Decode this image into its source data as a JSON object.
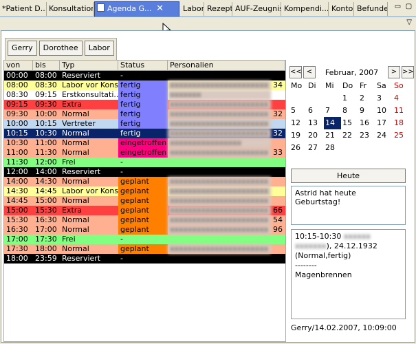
{
  "tabs": [
    {
      "label": "*Patient D..."
    },
    {
      "label": "Konsultation"
    },
    {
      "label": "Agenda G...",
      "active": true
    },
    {
      "label": "Labor"
    },
    {
      "label": "Rezept"
    },
    {
      "label": "AUF-Zeugnis"
    },
    {
      "label": "Kompendi..."
    },
    {
      "label": "Konto"
    },
    {
      "label": "Befunde"
    }
  ],
  "toolbar": {
    "buttons": [
      "Gerry",
      "Dorothee",
      "Labor"
    ]
  },
  "grid": {
    "headers": [
      "von",
      "bis",
      "Typ",
      "Status",
      "Personalien"
    ],
    "rows": [
      {
        "von": "00:00",
        "bis": "08:00",
        "typ": "Reserviert",
        "status": "-",
        "pers": "",
        "extra": "",
        "rowbg": "#000000",
        "fg": "#ffffff",
        "statusbg": "#000000"
      },
      {
        "von": "08:00",
        "bis": "08:30",
        "typ": "Labor vor Kons",
        "status": "fertig",
        "pers": "xxxxxxxxxxxxxxxxxxxxxx",
        "extra": "34",
        "rowbg": "#ffff99",
        "fg": "#000000",
        "statusbg": "#8080ff"
      },
      {
        "von": "08:30",
        "bis": "09:15",
        "typ": "Erstkonsultati...",
        "status": "fertig",
        "pers": "xxxxxxx",
        "extra": "",
        "rowbg": "#ffffff",
        "fg": "#000000",
        "statusbg": "#8080ff"
      },
      {
        "von": "09:15",
        "bis": "09:30",
        "typ": "Extra",
        "status": "fertig",
        "pers": "xxxxxxxxxxxxxxxxxxxxxx",
        "extra": "",
        "rowbg": "#ff4040",
        "fg": "#000000",
        "statusbg": "#8080ff"
      },
      {
        "von": "09:30",
        "bis": "10:00",
        "typ": "Normal",
        "status": "fertig",
        "pers": "xxxxxxxxxxxxxxxxxxxxxx",
        "extra": "32",
        "rowbg": "#ffb090",
        "fg": "#000000",
        "statusbg": "#8080ff"
      },
      {
        "von": "10:00",
        "bis": "10:15",
        "typ": "Vertreter",
        "status": "fertig",
        "pers": "xxxxxxxxxxxxxxxxxxxxxx",
        "extra": "",
        "rowbg": "#c0d8f0",
        "fg": "#000000",
        "statusbg": "#8080ff"
      },
      {
        "von": "10:15",
        "bis": "10:30",
        "typ": "Normal",
        "status": "fertig",
        "pers": "xxxxxxxxxxxxxxxxxxxxxx",
        "extra": "32",
        "rowbg": "#0a246a",
        "fg": "#ffffff",
        "statusbg": "#0a246a"
      },
      {
        "von": "10:30",
        "bis": "11:00",
        "typ": "Normal",
        "status": "eingetroffen",
        "pers": "xxxxxxxxxxxxxxxx",
        "extra": "",
        "rowbg": "#ffb090",
        "fg": "#000000",
        "statusbg": "#ff0080"
      },
      {
        "von": "11:00",
        "bis": "11:30",
        "typ": "Normal",
        "status": "eingetroffen",
        "pers": "xxxxxxxxxxxxxxxxxxxxxx",
        "extra": "33",
        "rowbg": "#ffb090",
        "fg": "#000000",
        "statusbg": "#ff0080"
      },
      {
        "von": "11:30",
        "bis": "12:00",
        "typ": "Frei",
        "status": "-",
        "pers": "",
        "extra": "",
        "rowbg": "#80ff80",
        "fg": "#000000",
        "statusbg": "#80ff80"
      },
      {
        "von": "12:00",
        "bis": "14:00",
        "typ": "Reserviert",
        "status": "-",
        "pers": "",
        "extra": "",
        "rowbg": "#000000",
        "fg": "#ffffff",
        "statusbg": "#000000"
      },
      {
        "von": "14:00",
        "bis": "14:30",
        "typ": "Normal",
        "status": "geplant",
        "pers": "xxxxxxxxxxxxxxxxxxxxxx",
        "extra": "",
        "rowbg": "#ffb090",
        "fg": "#000000",
        "statusbg": "#ff8000"
      },
      {
        "von": "14:30",
        "bis": "14:45",
        "typ": "Labor vor Kons",
        "status": "geplant",
        "pers": "xxxxxxxxxxxxxxxxxxxxxx",
        "extra": "",
        "rowbg": "#ffff99",
        "fg": "#000000",
        "statusbg": "#ff8000"
      },
      {
        "von": "14:45",
        "bis": "15:00",
        "typ": "Normal",
        "status": "geplant",
        "pers": "xxxxxxxxxxxxxxxxxxxxxx",
        "extra": "",
        "rowbg": "#ffb090",
        "fg": "#000000",
        "statusbg": "#ff8000"
      },
      {
        "von": "15:00",
        "bis": "15:30",
        "typ": "Extra",
        "status": "geplant",
        "pers": "xxxxxxxxxxxxxxxxxxxxxx",
        "extra": "66",
        "rowbg": "#ff4040",
        "fg": "#000000",
        "statusbg": "#ff8000"
      },
      {
        "von": "15:30",
        "bis": "16:30",
        "typ": "Normal",
        "status": "geplant",
        "pers": "xxxxxxxxxxxxxxxxxxxxxx",
        "extra": "54",
        "rowbg": "#ffb090",
        "fg": "#000000",
        "statusbg": "#ff8000"
      },
      {
        "von": "16:30",
        "bis": "17:00",
        "typ": "Normal",
        "status": "geplant",
        "pers": "xxxxxxxxxxxxxxxxxxxxxx",
        "extra": "96",
        "rowbg": "#ffb090",
        "fg": "#000000",
        "statusbg": "#ff8000"
      },
      {
        "von": "17:00",
        "bis": "17:30",
        "typ": "Frei",
        "status": "-",
        "pers": "",
        "extra": "",
        "rowbg": "#80ff80",
        "fg": "#000000",
        "statusbg": "#80ff80"
      },
      {
        "von": "17:30",
        "bis": "18:00",
        "typ": "Normal",
        "status": "geplant",
        "pers": "xxxxxxxxxxxxxxxxxxxxxx",
        "extra": "",
        "rowbg": "#ffb090",
        "fg": "#000000",
        "statusbg": "#ff8000"
      },
      {
        "von": "18:00",
        "bis": "23:59",
        "typ": "Reserviert",
        "status": "-",
        "pers": "",
        "extra": "",
        "rowbg": "#000000",
        "fg": "#ffffff",
        "statusbg": "#000000"
      }
    ]
  },
  "calendar": {
    "nav": {
      "first": "<<",
      "prev": "<",
      "next": ">",
      "last": ">>"
    },
    "month": "Februar, 2007",
    "weekdays": [
      "Mo",
      "Di",
      "Mi",
      "Do",
      "Fr",
      "Sa",
      "So"
    ],
    "weeks": [
      [
        "",
        "",
        "",
        "1",
        "2",
        "3",
        "4"
      ],
      [
        "5",
        "6",
        "7",
        "8",
        "9",
        "10",
        "11"
      ],
      [
        "12",
        "13",
        "14",
        "15",
        "16",
        "17",
        "18"
      ],
      [
        "19",
        "20",
        "21",
        "22",
        "23",
        "24",
        "25"
      ],
      [
        "26",
        "27",
        "28",
        "",
        "",
        "",
        ""
      ]
    ],
    "selected": "14"
  },
  "heute_label": "Heute",
  "birthday_text": "Astrid hat heute Geburtstag!",
  "details": {
    "line1": "10:15-10:30",
    "line2": "),  24.12.1932",
    "line3": "(Normal,fertig)",
    "line4": "--------",
    "line5": "Magenbrennen"
  },
  "footer": "Gerry/14.02.2007, 10:09:00"
}
